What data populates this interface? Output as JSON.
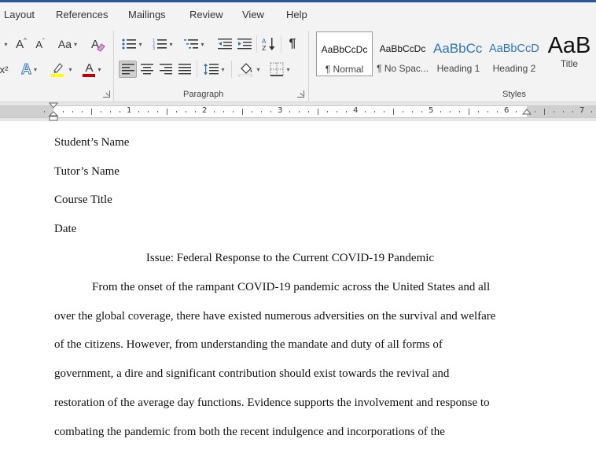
{
  "menu": {
    "tabs": [
      {
        "label": "Layout"
      },
      {
        "label": "References"
      },
      {
        "label": "Mailings"
      },
      {
        "label": "Review"
      },
      {
        "label": "View"
      },
      {
        "label": "Help"
      }
    ]
  },
  "ribbon": {
    "font": {
      "grow_label": "A",
      "shrink_label": "A",
      "case_label": "Aa",
      "text_effects_label": "A",
      "font_color_label": "A",
      "font_color": "#c00000",
      "highlight_color": "#ffff00"
    },
    "paragraph": {
      "group_label": "Paragraph",
      "show_marks_label": "¶"
    },
    "styles": {
      "group_label": "Styles",
      "items": [
        {
          "preview": "AaBbCcDc",
          "name": "¶ Normal"
        },
        {
          "preview": "AaBbCcDc",
          "name": "¶ No Spac..."
        },
        {
          "preview": "AaBbCc",
          "name": "Heading 1"
        },
        {
          "preview": "AaBbCcD",
          "name": "Heading 2"
        },
        {
          "preview": "AaB",
          "name": "Title"
        }
      ]
    }
  },
  "ruler": {
    "numbers": [
      "1",
      "2",
      "3",
      "4",
      "5",
      "6",
      "7"
    ]
  },
  "document": {
    "header_lines": [
      "Student’s Name",
      "Tutor’s Name",
      "Course Title",
      "Date"
    ],
    "title": "Issue: Federal Response to the Current COVID-19 Pandemic",
    "paragraph_lines": [
      "From the onset of the rampant COVID-19 pandemic across the United States and all",
      "over the global coverage, there have existed numerous adversities on the survival and welfare",
      "of the citizens. However, from understanding the mandate and duty of all forms of",
      "government, a dire and significant contribution should exist towards the revival and",
      "restoration of the average day functions. Evidence supports the involvement and response to",
      "combating the pandemic from both the recent indulgence and incorporations of the"
    ]
  },
  "colors": {
    "accent": "#2b579a",
    "heading_blue": "#2e74b5"
  }
}
